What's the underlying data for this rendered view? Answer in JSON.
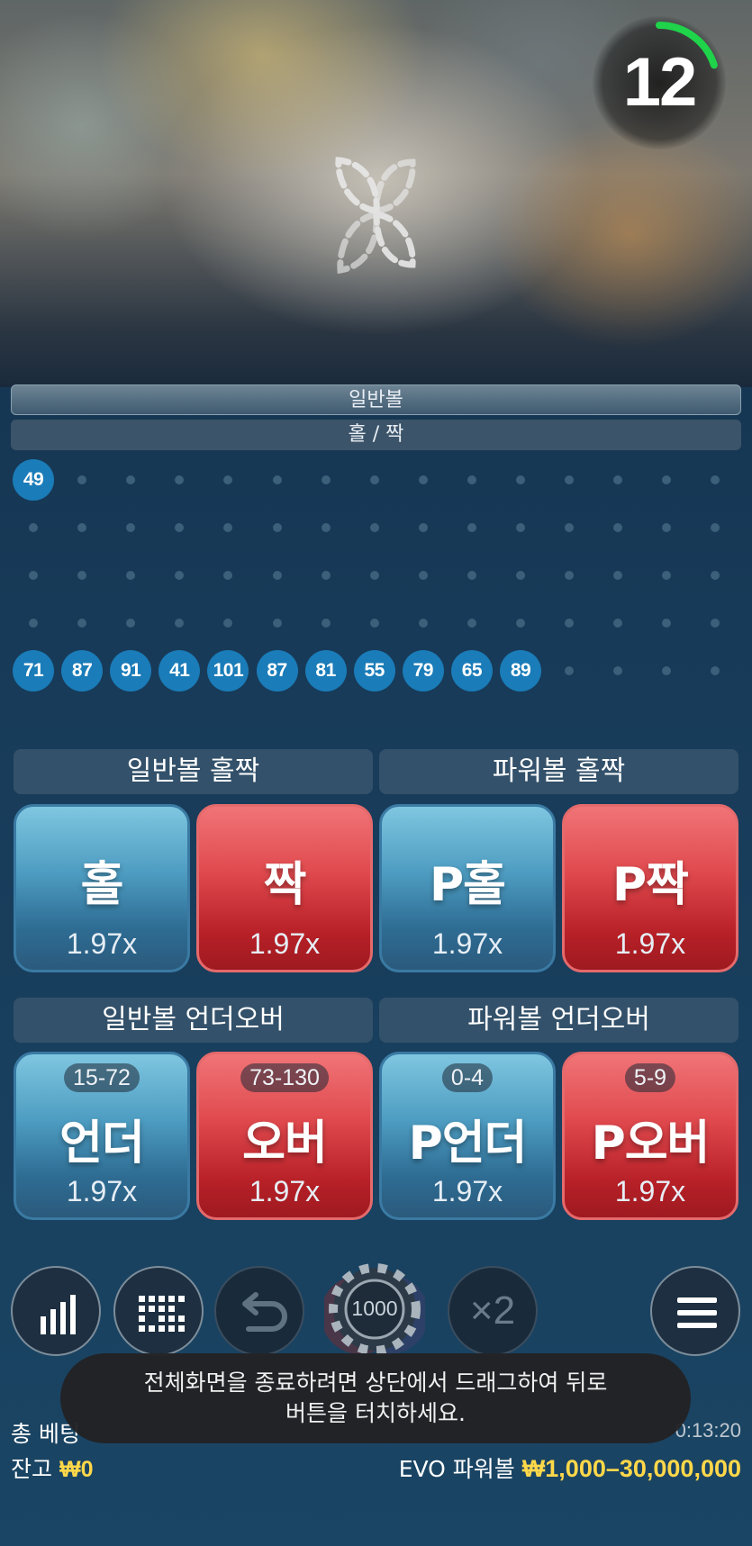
{
  "timer": {
    "value": "12",
    "progress": 0.2
  },
  "tabs": {
    "main": "일반볼",
    "sub": "홀 / 짝"
  },
  "roadmap": {
    "top_ball": "49",
    "bottom_balls": [
      "71",
      "87",
      "91",
      "41",
      "101",
      "87",
      "81",
      "55",
      "79",
      "65",
      "89"
    ]
  },
  "sections": {
    "normal_oddeven": "일반볼 홀짝",
    "power_oddeven": "파워볼 홀짝",
    "normal_underover": "일반볼 언더오버",
    "power_underover": "파워볼 언더오버"
  },
  "bets": {
    "odd": {
      "label": "홀",
      "odds": "1.97x"
    },
    "even": {
      "label": "짝",
      "odds": "1.97x"
    },
    "p_odd": {
      "label": "P홀",
      "odds": "1.97x"
    },
    "p_even": {
      "label": "P짝",
      "odds": "1.97x"
    },
    "under": {
      "label": "언더",
      "odds": "1.97x",
      "range": "15-72"
    },
    "over": {
      "label": "오버",
      "odds": "1.97x",
      "range": "73-130"
    },
    "p_under": {
      "label": "P언더",
      "odds": "1.97x",
      "range": "0-4"
    },
    "p_over": {
      "label": "P오버",
      "odds": "1.97x",
      "range": "5-9"
    }
  },
  "controls": {
    "chip_value": "1000",
    "double_label": "×2"
  },
  "footer": {
    "total_bet_label": "총 베팅",
    "time": "0:13:20",
    "balance_label": "잔고",
    "balance_value": "₩0",
    "game_name": "EVO 파워볼",
    "limits": "₩1,000–30,000,000"
  },
  "toast": {
    "line1": "전체화면을 종료하려면 상단에서 드래그하여 뒤로",
    "line2": "버튼을 터치하세요."
  },
  "colors": {
    "accent_green": "#1fd34a",
    "ball_blue": "#1a7cb8",
    "bet_blue": "#4e9dc2",
    "bet_red": "#d63a40",
    "highlight_yellow": "#ffd84a"
  }
}
